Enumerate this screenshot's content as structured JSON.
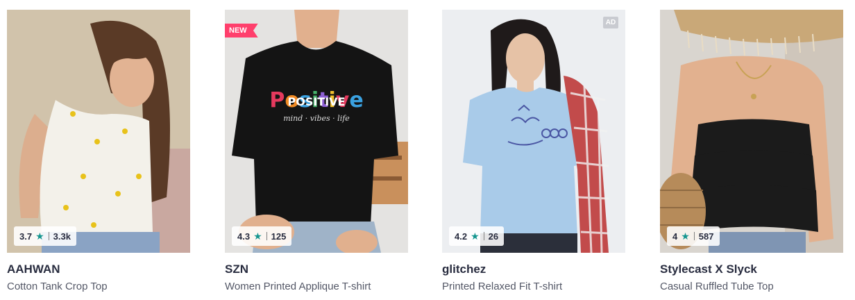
{
  "products": [
    {
      "brand": "AAHWAN",
      "name": "Cotton Tank Crop Top",
      "rating": "3.7",
      "rating_count": "3.3k",
      "star_icon": "★"
    },
    {
      "brand": "SZN",
      "name": "Women Printed Applique T-shirt",
      "rating": "4.3",
      "rating_count": "125",
      "star_icon": "★",
      "badge": "NEW",
      "print_title": "POSITIVE",
      "print_subtitle": "mind · vibes · life"
    },
    {
      "brand": "glitchez",
      "name": "Printed Relaxed Fit T-shirt",
      "rating": "4.2",
      "rating_count": "26",
      "star_icon": "★",
      "ad_label": "AD"
    },
    {
      "brand": "Stylecast X Slyck",
      "name": "Casual Ruffled Tube Top",
      "rating": "4",
      "rating_count": "587",
      "star_icon": "★"
    }
  ],
  "colors": {
    "star": "#14958f",
    "new_badge": "#ff3f6c",
    "brand_text": "#282c3f",
    "name_text": "#535766"
  }
}
